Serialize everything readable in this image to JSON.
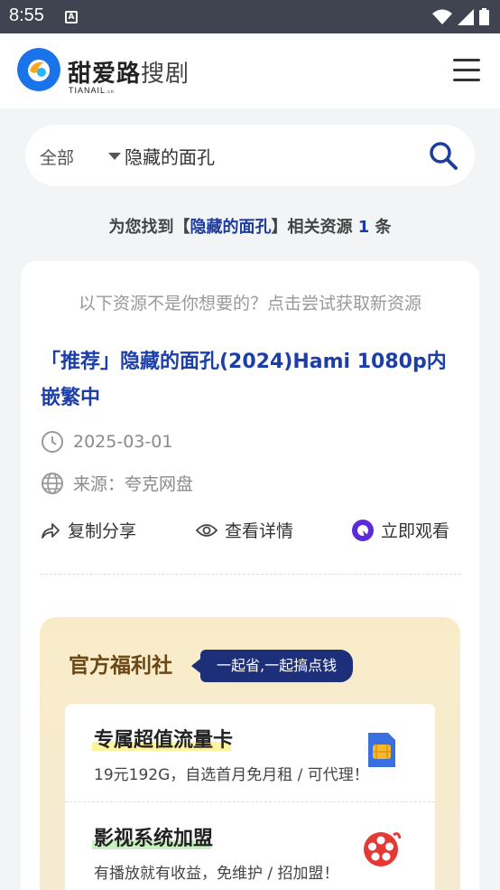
{
  "status_bar": {
    "time": "8:55",
    "notification_icon": "A"
  },
  "app_bar": {
    "brand": "甜爱路",
    "brand_sub": "搜剧",
    "brand_en": "TIANAIL",
    "brand_en_suffix": ".cn"
  },
  "search": {
    "scope": "全部",
    "query": "隐藏的面孔"
  },
  "result": {
    "prefix": "为您找到【",
    "keyword": "隐藏的面孔",
    "middle": "】相关资源 ",
    "count": "1",
    "suffix": " 条"
  },
  "card": {
    "hint": "以下资源不是你想要的？点击尝试获取新资源",
    "title": "「推荐」隐藏的面孔(2024)Hami 1080p内嵌繁中",
    "date": "2025-03-01",
    "source": "来源：夸克网盘",
    "actions": {
      "share": "复制分享",
      "details": "查看详情",
      "watch": "立即观看"
    }
  },
  "promo": {
    "title": "官方福利社",
    "tag": "一起省,一起搞点钱",
    "items": [
      {
        "name": "专属超值流量卡",
        "desc": "19元192G，自选首月免月租 / 可代理！",
        "highlight": "#fff3a0",
        "icon": "sim-card-icon"
      },
      {
        "name": "影视系统加盟",
        "desc": "有播放就有收益，免维护 / 招加盟！",
        "highlight": "#c9f0c2",
        "icon": "film-reel-icon"
      }
    ]
  },
  "colors": {
    "accent": "#1b3ea8",
    "status_bar": "#3f4450",
    "promo_brown": "#6b4616",
    "tag_navy": "#1e2f7a"
  }
}
